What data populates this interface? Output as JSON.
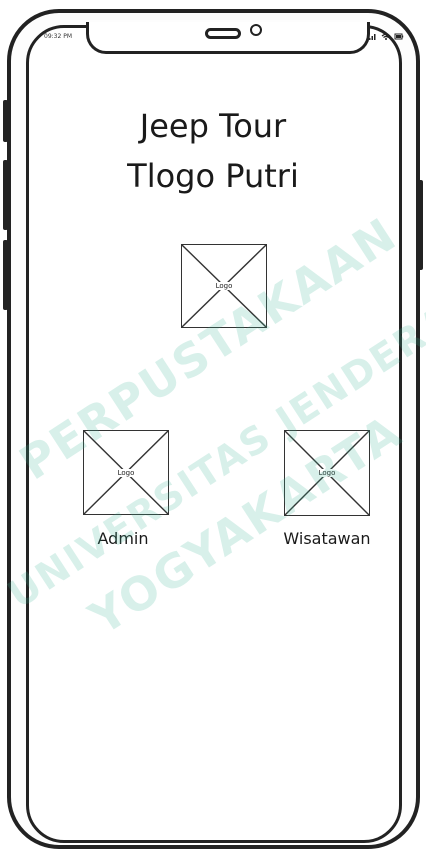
{
  "status_bar": {
    "time": "09:32 PM",
    "icons": [
      "signal-icon",
      "wifi-icon",
      "battery-icon"
    ]
  },
  "app": {
    "title_line1": "Jeep Tour",
    "title_line2": "Tlogo Putri"
  },
  "logo_main": {
    "label": "Logo"
  },
  "roles": [
    {
      "placeholder_label": "Logo",
      "label": "Admin"
    },
    {
      "placeholder_label": "Logo",
      "label": "Wisatawan"
    }
  ],
  "watermark": {
    "line1": "PERPUSTAKAAN",
    "line2": "UNIVERSITAS JENDERAL ACHMAD YANI",
    "line3": "YOGYAKARTA",
    "color": "#3cb496"
  },
  "colors": {
    "frame": "#222222",
    "background": "#ffffff",
    "text": "#1a1a1a"
  }
}
